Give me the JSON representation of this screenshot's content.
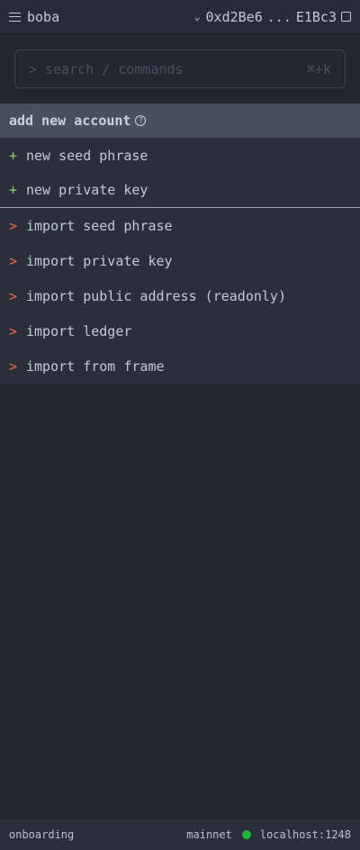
{
  "header": {
    "title": "boba",
    "address_start": "0xd2Be6",
    "ellipsis": "...",
    "address_end": "E1Bc3"
  },
  "search": {
    "placeholder": "> search / commands",
    "shortcut": "⌘+k"
  },
  "section": {
    "title": "add new account",
    "help": "?"
  },
  "items": [
    {
      "prefix": "+",
      "label": "new seed phrase"
    },
    {
      "prefix": "+",
      "label": "new private key"
    },
    {
      "prefix": ">",
      "label": "import seed phrase"
    },
    {
      "prefix": ">",
      "label": "import private key"
    },
    {
      "prefix": ">",
      "label": "import public address (readonly)"
    },
    {
      "prefix": ">",
      "label": "import ledger"
    },
    {
      "prefix": ">",
      "label": "import from frame"
    }
  ],
  "footer": {
    "mode": "onboarding",
    "network": "mainnet",
    "status_color": "#1db83b",
    "host": "localhost:1248"
  }
}
